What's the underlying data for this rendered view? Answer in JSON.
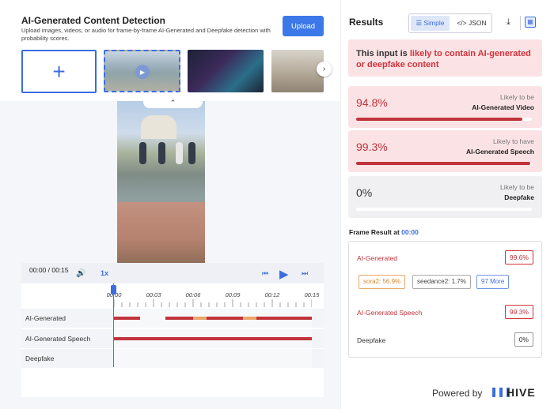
{
  "header": {
    "title": "AI-Generated Content Detection",
    "subtitle": "Upload images, videos, or audio for frame-by-frame AI-Generated and Deepfake detection with probability scores.",
    "upload_label": "Upload",
    "add_glyph": "+"
  },
  "icons": {
    "add": "plus-icon",
    "next": "chevron-right-icon",
    "collapse": "chevron-up-icon",
    "volume": "volume-icon",
    "skip_back": "skip-back-icon",
    "play": "play-icon",
    "skip_forward": "skip-forward-icon",
    "download": "download-icon",
    "frame_view": "frame-view-icon",
    "hive": "hive-logo-icon"
  },
  "player": {
    "time": "00:00 / 00:15",
    "speed": "1x",
    "ticks": [
      "00:00",
      "00:03",
      "00:06",
      "00:09",
      "00:12",
      "00:15"
    ],
    "duration_s": 15,
    "tracks": [
      {
        "label": "AI-Generated",
        "segments": [
          {
            "start": 0.0,
            "end": 2.0,
            "color": "#c0333a"
          },
          {
            "start": 3.9,
            "end": 6.0,
            "color": "#c0333a"
          },
          {
            "start": 6.0,
            "end": 7.0,
            "color": "#e8a76a"
          },
          {
            "start": 7.0,
            "end": 9.8,
            "color": "#c0333a"
          },
          {
            "start": 9.8,
            "end": 10.8,
            "color": "#e8a76a"
          },
          {
            "start": 10.8,
            "end": 15.0,
            "color": "#c0333a"
          }
        ]
      },
      {
        "label": "AI-Generated Speech",
        "segments": [
          {
            "start": 0.0,
            "end": 15.0,
            "color": "#c0333a"
          }
        ]
      },
      {
        "label": "Deepfake",
        "segments": []
      }
    ]
  },
  "results": {
    "title": "Results",
    "toggle_simple": "Simple",
    "toggle_json": "</> JSON",
    "alert_prefix": "This input is ",
    "alert_highlight": "likely to contain AI-generated or deepfake content",
    "cards": [
      {
        "percent": "94.8%",
        "value": 0.948,
        "label_top": "Likely to be",
        "label_bottom": "AI-Generated Video",
        "style": "red"
      },
      {
        "percent": "99.3%",
        "value": 0.993,
        "label_top": "Likely to have",
        "label_bottom": "AI-Generated Speech",
        "style": "red"
      },
      {
        "percent": "0%",
        "value": 0.0,
        "label_top": "Likely to be",
        "label_bottom": "Deepfake",
        "style": "grey"
      }
    ]
  },
  "frame_result": {
    "prefix": "Frame Result at ",
    "time": "00:00",
    "ai_generated_label": "AI-Generated",
    "ai_generated_value": "99.6%",
    "chips": [
      "sora2: 56.9%",
      "seedance2: 1.7%",
      "97 More"
    ],
    "speech_label": "AI-Generated Speech",
    "speech_value": "99.3%",
    "deepfake_label": "Deepfake",
    "deepfake_value": "0%"
  },
  "footer": {
    "powered_by": "Powered by",
    "brand": "HIVE"
  },
  "colors": {
    "accent": "#3c6de0",
    "danger": "#c0333a",
    "warning": "#e8a76a"
  }
}
